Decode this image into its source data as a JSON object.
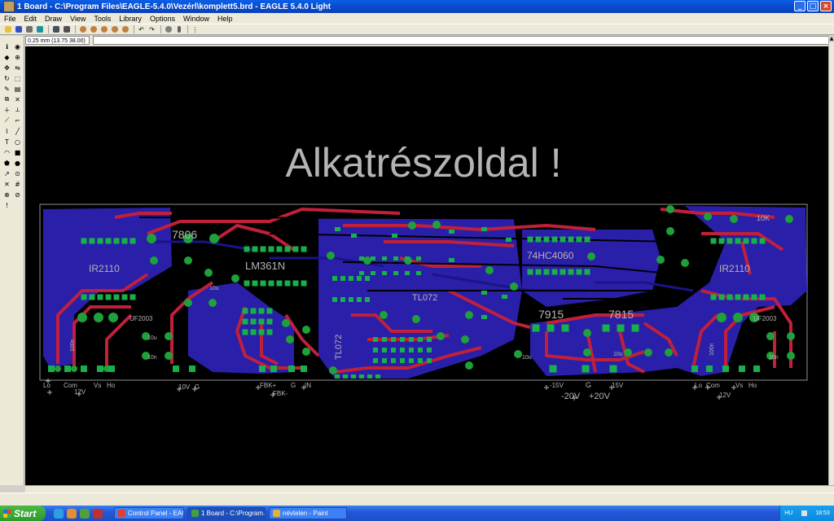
{
  "window": {
    "title": "1 Board - C:\\Program Files\\EAGLE-5.4.0\\Vezérl\\komplett5.brd - EAGLE 5.4.0 Light",
    "app_icon": "eagle-board-icon",
    "controls": {
      "minimize": "_",
      "maximize": "□",
      "close": "×"
    }
  },
  "menu": [
    "File",
    "Edit",
    "Draw",
    "View",
    "Tools",
    "Library",
    "Options",
    "Window",
    "Help"
  ],
  "toolbar_icons": [
    "open-icon",
    "save-icon",
    "print-icon",
    "cam-icon",
    "script-icon",
    "run-icon",
    "zoom-fit-icon",
    "zoom-in-icon",
    "zoom-out-icon",
    "zoom-redraw-icon",
    "zoom-select-icon",
    "undo-icon",
    "redo-icon",
    "stop-icon",
    "go-icon",
    "grid-icon"
  ],
  "coordinates": "0.25 mm (13.75 38.00)",
  "left_tools": [
    {
      "name": "info-icon",
      "glyph": "ℹ"
    },
    {
      "name": "eye-icon",
      "glyph": "◉"
    },
    {
      "name": "layer-icon",
      "glyph": "◆"
    },
    {
      "name": "mark-icon",
      "glyph": "⊕"
    },
    {
      "name": "move-icon",
      "glyph": "✥"
    },
    {
      "name": "mirror-icon",
      "glyph": "⇋"
    },
    {
      "name": "rotate-icon",
      "glyph": "↻"
    },
    {
      "name": "group-icon",
      "glyph": "⬚"
    },
    {
      "name": "change-icon",
      "glyph": "✎"
    },
    {
      "name": "paste-icon",
      "glyph": "▤"
    },
    {
      "name": "copy-icon",
      "glyph": "⧉"
    },
    {
      "name": "delete-icon",
      "glyph": "✕"
    },
    {
      "name": "add-icon",
      "glyph": "＋"
    },
    {
      "name": "split-icon",
      "glyph": "⟂"
    },
    {
      "name": "optimize-icon",
      "glyph": "⟋"
    },
    {
      "name": "route-icon",
      "glyph": "⌐"
    },
    {
      "name": "ripup-icon",
      "glyph": "⌇"
    },
    {
      "name": "wire-icon",
      "glyph": "╱"
    },
    {
      "name": "text-icon",
      "glyph": "T"
    },
    {
      "name": "circle-icon",
      "glyph": "○"
    },
    {
      "name": "arc-icon",
      "glyph": "◠"
    },
    {
      "name": "rect-icon",
      "glyph": "■"
    },
    {
      "name": "polygon-icon",
      "glyph": "⬟"
    },
    {
      "name": "via-icon",
      "glyph": "●"
    },
    {
      "name": "signal-icon",
      "glyph": "↗"
    },
    {
      "name": "hole-icon",
      "glyph": "⊙"
    },
    {
      "name": "ratsnest-icon",
      "glyph": "✕"
    },
    {
      "name": "autoroute-icon",
      "glyph": "#"
    },
    {
      "name": "drc-icon",
      "glyph": "⊕"
    },
    {
      "name": "errors-icon",
      "glyph": "⊘"
    },
    {
      "name": "warning-icon",
      "glyph": "!"
    }
  ],
  "board": {
    "heading": "Alkatrészoldal !",
    "components": [
      {
        "id": "c7806",
        "label": "7806"
      },
      {
        "id": "cir2110l",
        "label": "IR2110"
      },
      {
        "id": "cuf2003l",
        "label": "UF2003"
      },
      {
        "id": "clm361n",
        "label": "LM361N"
      },
      {
        "id": "ctl072a",
        "label": "TL072"
      },
      {
        "id": "ctl072b",
        "label": "TL072"
      },
      {
        "id": "c74hc",
        "label": "74HC4060"
      },
      {
        "id": "c7915",
        "label": "7915"
      },
      {
        "id": "c7815",
        "label": "7815"
      },
      {
        "id": "cir2110r",
        "label": "IR2110"
      },
      {
        "id": "cuf2003r",
        "label": "UF2003"
      },
      {
        "id": "c10k",
        "label": "10K"
      }
    ],
    "small_labels": [
      {
        "id": "s100n",
        "text": "100n"
      },
      {
        "id": "s10ua",
        "text": "10u"
      },
      {
        "id": "s10na",
        "text": "10n"
      },
      {
        "id": "s10ub",
        "text": "10u"
      },
      {
        "id": "s100nb",
        "text": "100n"
      },
      {
        "id": "s10nb",
        "text": "10n"
      },
      {
        "id": "s10uc",
        "text": "10u"
      },
      {
        "id": "s10ud",
        "text": "10u"
      }
    ],
    "connectors": [
      {
        "id": "lo_l",
        "text": "Lo"
      },
      {
        "id": "com_l",
        "text": "Com"
      },
      {
        "id": "vs_l",
        "text": "Vs"
      },
      {
        "id": "ho_l",
        "text": "Ho"
      },
      {
        "id": "v12_l",
        "text": "12V"
      },
      {
        "id": "v10",
        "text": "10V"
      },
      {
        "id": "g1",
        "text": "G"
      },
      {
        "id": "fbkp",
        "text": "FBK+"
      },
      {
        "id": "fbkm",
        "text": "FBK-"
      },
      {
        "id": "g2",
        "text": "G"
      },
      {
        "id": "in",
        "text": "IN"
      },
      {
        "id": "m15",
        "text": "-15V"
      },
      {
        "id": "g3",
        "text": "G"
      },
      {
        "id": "p15",
        "text": "15V"
      },
      {
        "id": "m20",
        "text": "-20V"
      },
      {
        "id": "p20",
        "text": "+20V"
      },
      {
        "id": "lo_r",
        "text": "Lo"
      },
      {
        "id": "com_r",
        "text": "Com"
      },
      {
        "id": "vs_r",
        "text": "Vs"
      },
      {
        "id": "ho_r",
        "text": "Ho"
      },
      {
        "id": "v12_r",
        "text": "12V"
      }
    ]
  },
  "taskbar": {
    "start": "Start",
    "tasks": [
      {
        "label": "Control Panel - EAGL...",
        "icon": "eagle-icon",
        "active": false
      },
      {
        "label": "1 Board - C:\\Program...",
        "icon": "board-icon",
        "active": true
      },
      {
        "label": "névtelen - Paint",
        "icon": "paint-icon",
        "active": false
      }
    ],
    "tray": {
      "lang": "HU",
      "time": "18:53"
    }
  },
  "colors": {
    "canvas": "#000000",
    "top_copper": "#c0203a",
    "bottom_copper": "#2a1fa8",
    "pad": "#1ea03a",
    "smd": "#18b04a",
    "silk": "#b4b4b4",
    "dim_line": "#909090"
  }
}
